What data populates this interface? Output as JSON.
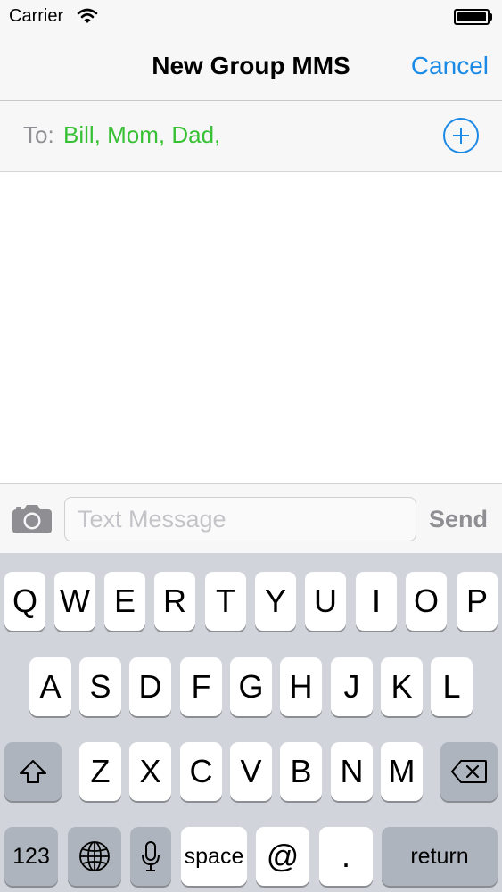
{
  "status_bar": {
    "carrier": "Carrier",
    "wifi_icon": "wifi-icon",
    "battery_icon": "battery-full-icon"
  },
  "nav": {
    "title": "New Group MMS",
    "cancel_label": "Cancel"
  },
  "to_field": {
    "label": "To:",
    "recipients": "Bill, Mom, Dad,",
    "add_icon": "plus-circle-icon"
  },
  "compose": {
    "camera_icon": "camera-icon",
    "placeholder": "Text Message",
    "send_label": "Send"
  },
  "keyboard": {
    "row1": [
      "Q",
      "W",
      "E",
      "R",
      "T",
      "Y",
      "U",
      "I",
      "O",
      "P"
    ],
    "row2": [
      "A",
      "S",
      "D",
      "F",
      "G",
      "H",
      "J",
      "K",
      "L"
    ],
    "row3": [
      "Z",
      "X",
      "C",
      "V",
      "B",
      "N",
      "M"
    ],
    "shift_icon": "shift-icon",
    "delete_icon": "delete-backward-icon",
    "numbers_label": "123",
    "globe_icon": "globe-icon",
    "mic_icon": "microphone-icon",
    "space_label": "space",
    "at_label": "@",
    "period_label": ".",
    "return_label": "return"
  },
  "colors": {
    "accent": "#1a8ae6",
    "recipient": "#38c135",
    "muted": "#8e8e93"
  }
}
